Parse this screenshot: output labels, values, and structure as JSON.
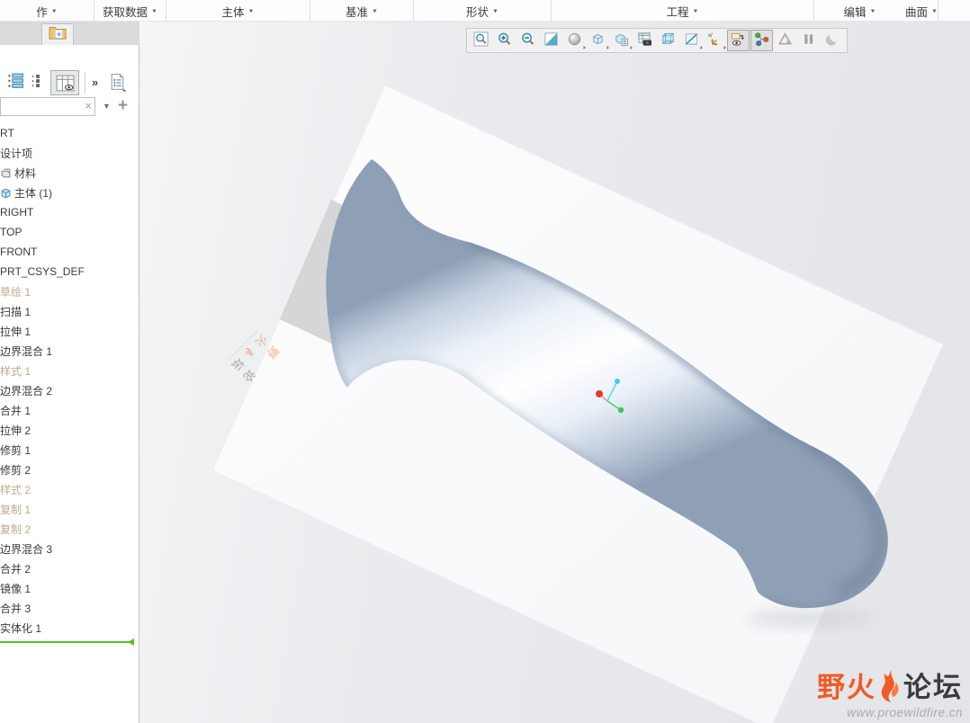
{
  "caret": "▼",
  "menu_bar": {
    "tabs": [
      {
        "label": "作"
      },
      {
        "label": "获取数据"
      },
      {
        "label": "主体"
      },
      {
        "label": "基准"
      },
      {
        "label": "形状"
      },
      {
        "label": "工程"
      },
      {
        "label": "编辑"
      },
      {
        "label": "曲面"
      }
    ]
  },
  "panel": {
    "overflow_label": "»",
    "search": {
      "value": "",
      "clear_label": "×",
      "dropdown_label": "▼",
      "add_label": "+"
    },
    "tree_items": [
      {
        "label": "RT"
      },
      {
        "label": "设计项"
      },
      {
        "label": "材料",
        "icon": "material"
      },
      {
        "label": "主体 (1)",
        "icon": "body"
      },
      {
        "label": "RIGHT"
      },
      {
        "label": "TOP"
      },
      {
        "label": "FRONT"
      },
      {
        "label": "PRT_CSYS_DEF"
      },
      {
        "label": "草绘 1",
        "state": "suppressed"
      },
      {
        "label": "扫描 1"
      },
      {
        "label": "拉伸 1"
      },
      {
        "label": "边界混合 1"
      },
      {
        "label": "样式 1",
        "state": "suppressed"
      },
      {
        "label": "边界混合 2"
      },
      {
        "label": "合并 1"
      },
      {
        "label": "拉伸 2"
      },
      {
        "label": "修剪 1"
      },
      {
        "label": "修剪 2"
      },
      {
        "label": "样式 2",
        "state": "suppressed"
      },
      {
        "label": "复制 1",
        "state": "suppressed"
      },
      {
        "label": "复制 2",
        "state": "suppressed"
      },
      {
        "label": "边界混合 3"
      },
      {
        "label": "合并 2"
      },
      {
        "label": "镜像 1"
      },
      {
        "label": "合并 3"
      },
      {
        "label": "实体化 1"
      }
    ]
  },
  "viewport_toolbar": {
    "buttons": [
      {
        "name": "zoom-region"
      },
      {
        "name": "zoom-in"
      },
      {
        "name": "zoom-out"
      },
      {
        "name": "repaint"
      },
      {
        "name": "shading-style",
        "dropdown": true
      },
      {
        "name": "display-style",
        "dropdown": true
      },
      {
        "name": "saved-orientations",
        "dropdown": true
      },
      {
        "name": "view-manager"
      },
      {
        "name": "perspective-view"
      },
      {
        "name": "sections",
        "dropdown": true
      },
      {
        "name": "datum-display-filters",
        "dropdown": true
      },
      {
        "name": "annotation-display",
        "state": "pressed"
      },
      {
        "name": "spin-center",
        "state": "pressed"
      },
      {
        "name": "object-dragger",
        "state": "disabled"
      },
      {
        "name": "pause",
        "state": "disabled"
      },
      {
        "name": "clipping",
        "state": "disabled"
      }
    ]
  },
  "watermark": {
    "brand_left": "野火",
    "brand_right": "论坛",
    "url": "www.proewildfire.cn"
  },
  "colors": {
    "brand_orange": "#f15b25",
    "insert_line_green": "#54c41e",
    "suppressed_text": "#bcab8d",
    "model_edge": "#8fa0b6",
    "model_highlight": "#ffffff",
    "spin_red": "#e33a2f",
    "spin_green": "#3fc94f",
    "spin_cyan": "#3ed0e8"
  }
}
